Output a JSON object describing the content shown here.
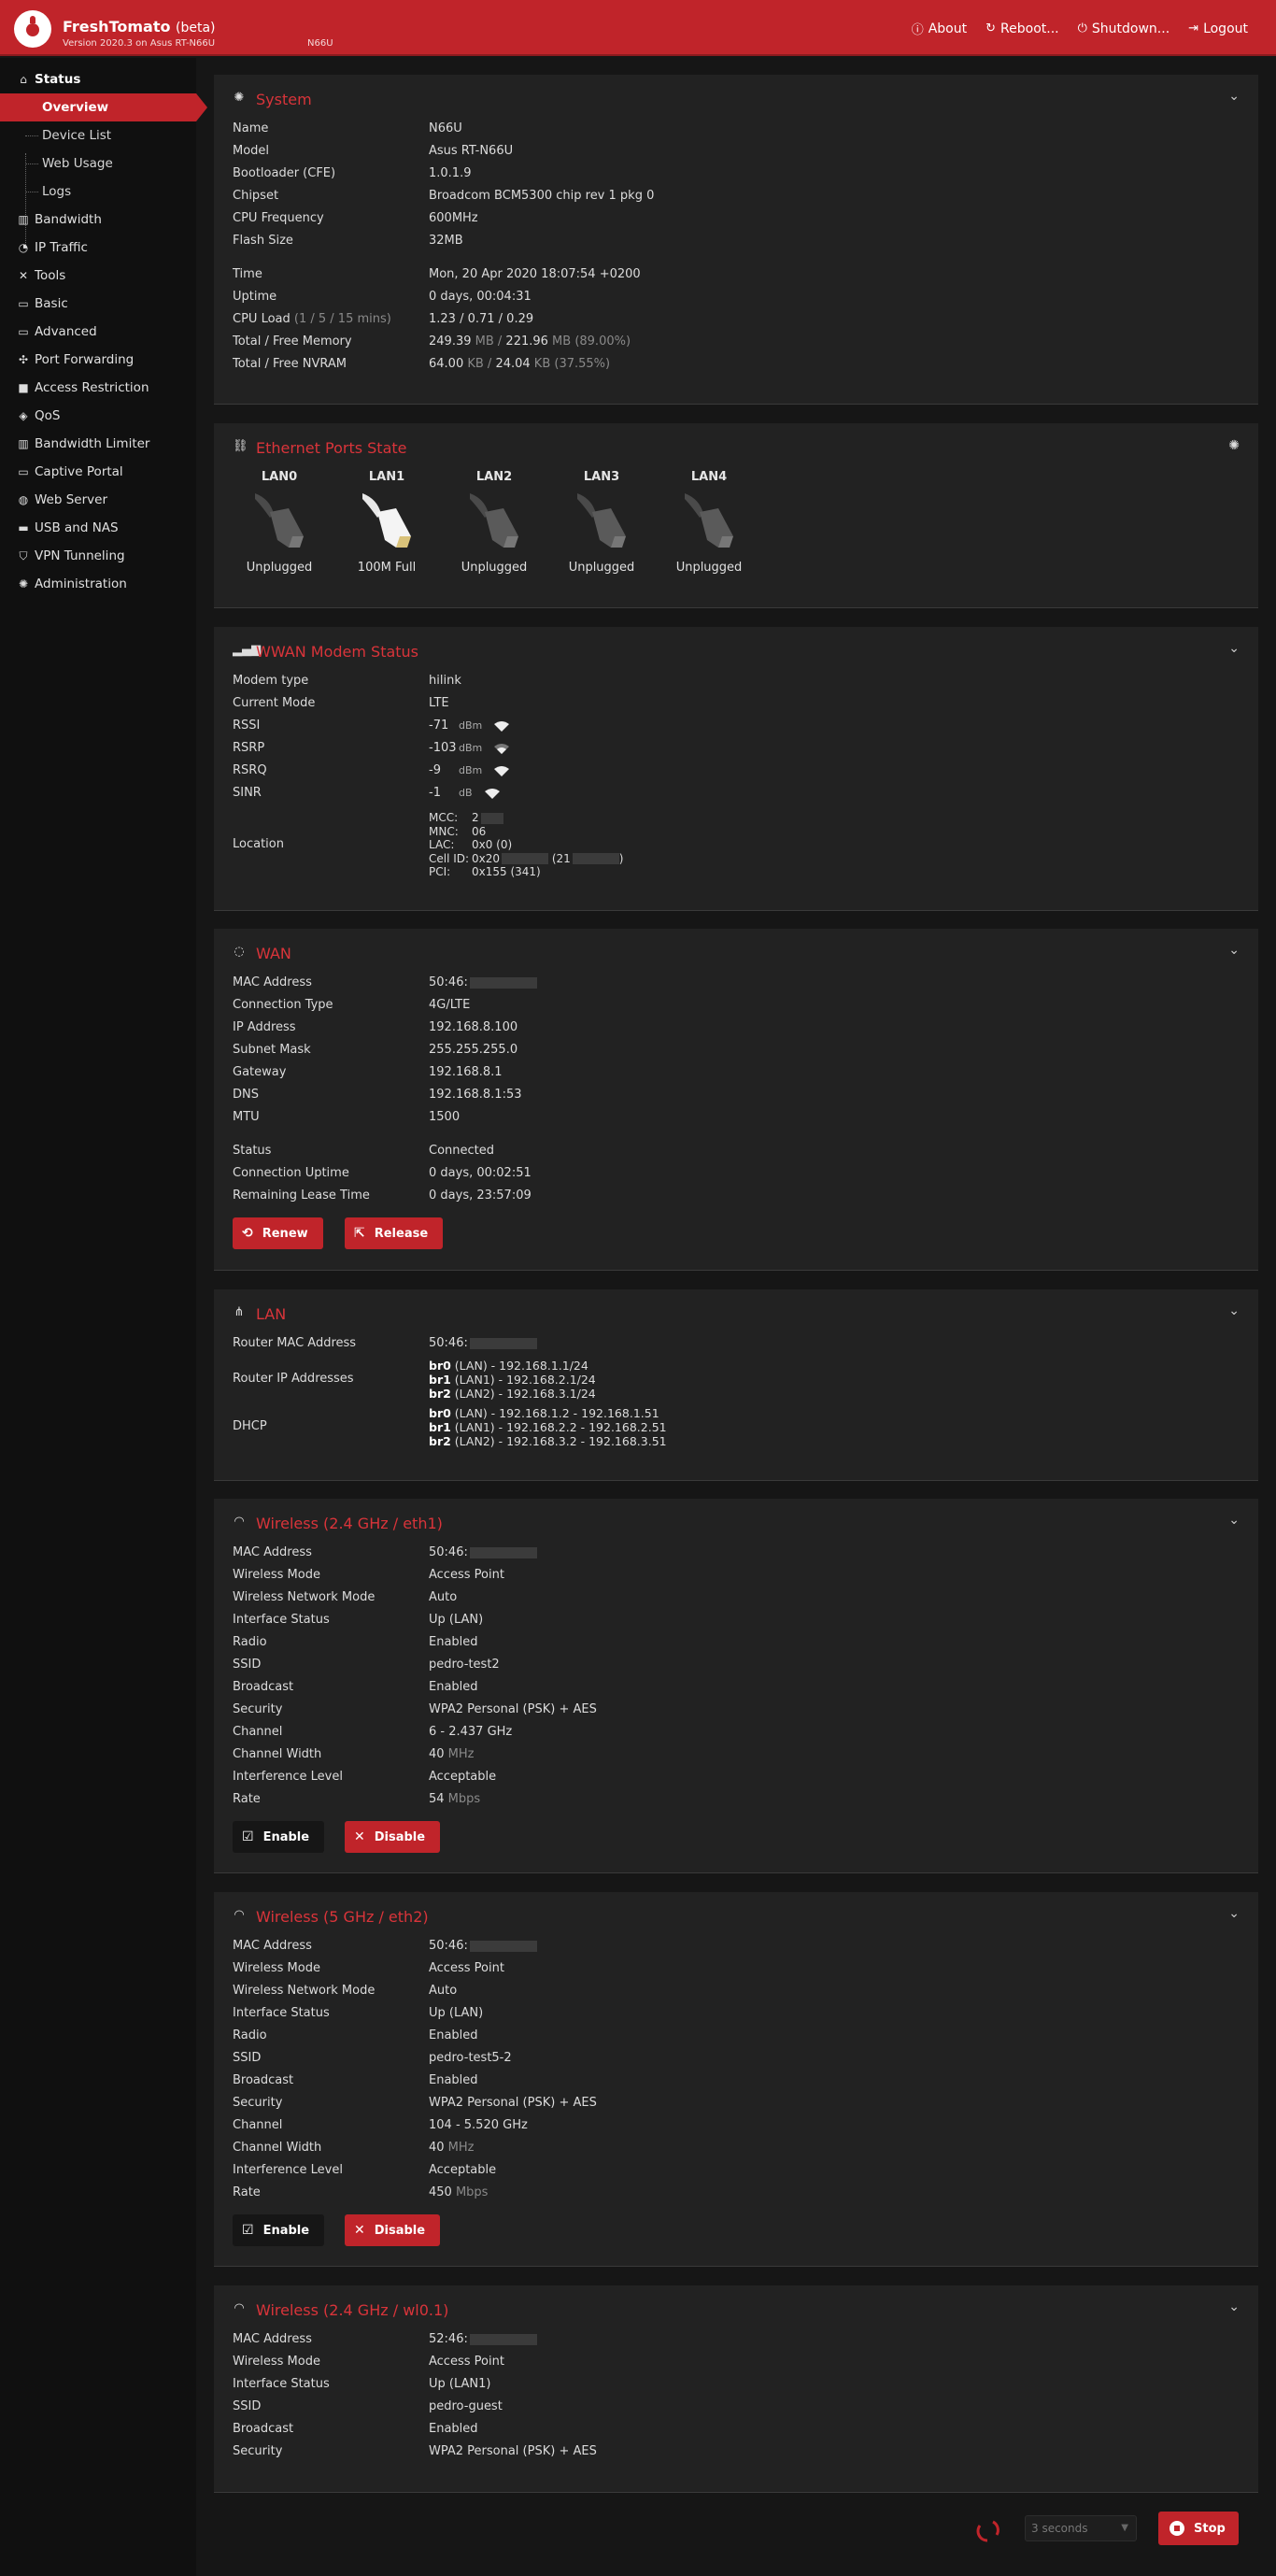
{
  "header": {
    "brand": "FreshTomato",
    "beta": "(beta)",
    "version": "Version 2020.3 on Asus RT-N66U",
    "router": "N66U",
    "links": {
      "about": "About",
      "reboot": "Reboot...",
      "shutdown": "Shutdown...",
      "logout": "Logout"
    }
  },
  "sidebar": {
    "status": "Status",
    "sub": {
      "overview": "Overview",
      "device_list": "Device List",
      "web_usage": "Web Usage",
      "logs": "Logs"
    },
    "items": {
      "bandwidth": "Bandwidth",
      "ip_traffic": "IP Traffic",
      "tools": "Tools",
      "basic": "Basic",
      "advanced": "Advanced",
      "port_forwarding": "Port Forwarding",
      "access_restriction": "Access Restriction",
      "qos": "QoS",
      "bandwidth_limiter": "Bandwidth Limiter",
      "captive_portal": "Captive Portal",
      "web_server": "Web Server",
      "usb_nas": "USB and NAS",
      "vpn": "VPN Tunneling",
      "administration": "Administration"
    }
  },
  "system": {
    "title": "System",
    "name_k": "Name",
    "name_v": "N66U",
    "model_k": "Model",
    "model_v": "Asus RT-N66U",
    "boot_k": "Bootloader (CFE)",
    "boot_v": "1.0.1.9",
    "chip_k": "Chipset",
    "chip_v": "Broadcom BCM5300 chip rev 1 pkg 0",
    "cpu_k": "CPU Frequency",
    "cpu_v": "600MHz",
    "flash_k": "Flash Size",
    "flash_v": "32MB",
    "time_k": "Time",
    "time_v": "Mon, 20 Apr 2020 18:07:54 +0200",
    "uptime_k": "Uptime",
    "uptime_v": "0 days, 00:04:31",
    "load_k": "CPU Load",
    "load_hint": "(1 / 5 / 15 mins)",
    "load_v": "1.23 / 0.71 / 0.29",
    "mem_k": "Total / Free Memory",
    "mem_a": "249.39",
    "mem_u1": " MB / ",
    "mem_b": "221.96",
    "mem_u2": " MB (89.00%)",
    "nvram_k": "Total / Free NVRAM",
    "nvram_a": "64.00",
    "nvram_u1": " KB / ",
    "nvram_b": "24.04",
    "nvram_u2": " KB (37.55%)"
  },
  "ports": {
    "title": "Ethernet Ports State",
    "list": [
      {
        "label": "LAN0",
        "state": "Unplugged"
      },
      {
        "label": "LAN1",
        "state": "100M Full"
      },
      {
        "label": "LAN2",
        "state": "Unplugged"
      },
      {
        "label": "LAN3",
        "state": "Unplugged"
      },
      {
        "label": "LAN4",
        "state": "Unplugged"
      }
    ]
  },
  "wwan": {
    "title": "WWAN Modem Status",
    "type_k": "Modem type",
    "type_v": "hilink",
    "mode_k": "Current Mode",
    "mode_v": "LTE",
    "rssi_k": "RSSI",
    "rssi_v": "-71",
    "rssi_u": "dBm",
    "rsrp_k": "RSRP",
    "rsrp_v": "-103",
    "rsrp_u": "dBm",
    "rsrq_k": "RSRQ",
    "rsrq_v": "-9",
    "rsrq_u": "dBm",
    "sinr_k": "SINR",
    "sinr_v": "-1",
    "sinr_u": "dB",
    "loc_k": "Location",
    "mcc": "MCC:",
    "mcc_v": "2",
    "mnc": "MNC:",
    "mnc_v": "06",
    "lac": "LAC:",
    "lac_v": "0x0 (0)",
    "cell": "Cell ID:",
    "cell_v": "0x20",
    "cell_v2": "(21",
    "cell_v3": ")",
    "pci": "PCI:",
    "pci_v": "0x155 (341)"
  },
  "wan": {
    "title": "WAN",
    "mac_k": "MAC Address",
    "mac_v": "50:46:",
    "ctype_k": "Connection Type",
    "ctype_v": "4G/LTE",
    "ip_k": "IP Address",
    "ip_v": "192.168.8.100",
    "mask_k": "Subnet Mask",
    "mask_v": "255.255.255.0",
    "gw_k": "Gateway",
    "gw_v": "192.168.8.1",
    "dns_k": "DNS",
    "dns_v": "192.168.8.1:53",
    "mtu_k": "MTU",
    "mtu_v": "1500",
    "status_k": "Status",
    "status_v": "Connected",
    "cup_k": "Connection Uptime",
    "cup_v": "0 days, 00:02:51",
    "lease_k": "Remaining Lease Time",
    "lease_v": "0 days, 23:57:09",
    "renew": "Renew",
    "release": "Release"
  },
  "lan": {
    "title": "LAN",
    "mac_k": "Router MAC Address",
    "mac_v": "50:46:",
    "ip_k": "Router IP Addresses",
    "ip": [
      {
        "br": "br0",
        "rest": " (LAN) - 192.168.1.1/24"
      },
      {
        "br": "br1",
        "rest": " (LAN1) - 192.168.2.1/24"
      },
      {
        "br": "br2",
        "rest": " (LAN2) - 192.168.3.1/24"
      }
    ],
    "dhcp_k": "DHCP",
    "dhcp": [
      {
        "br": "br0",
        "rest": " (LAN) - 192.168.1.2 - 192.168.1.51"
      },
      {
        "br": "br1",
        "rest": " (LAN1) - 192.168.2.2 - 192.168.2.51"
      },
      {
        "br": "br2",
        "rest": " (LAN2) - 192.168.3.2 - 192.168.3.51"
      }
    ]
  },
  "labels": {
    "mac": "MAC Address",
    "wmode": "Wireless Mode",
    "wnmode": "Wireless Network Mode",
    "istatus": "Interface Status",
    "radio": "Radio",
    "ssid": "SSID",
    "broadcast": "Broadcast",
    "security": "Security",
    "channel": "Channel",
    "cwidth": "Channel Width",
    "ilevel": "Interference Level",
    "rate": "Rate",
    "enable": "Enable",
    "disable": "Disable"
  },
  "w24": {
    "title": "Wireless (2.4 GHz / eth1)",
    "mac": "50:46:",
    "wmode": "Access Point",
    "wnmode": "Auto",
    "istatus": "Up (LAN)",
    "radio": "Enabled",
    "ssid": "pedro-test2",
    "broadcast": "Enabled",
    "security": "WPA2 Personal (PSK) + AES",
    "channel": "6 - 2.437 GHz",
    "cwidth": "40",
    "cwidth_u": " MHz",
    "ilevel": "Acceptable",
    "rate": "54",
    "rate_u": " Mbps"
  },
  "w5": {
    "title": "Wireless (5 GHz / eth2)",
    "mac": "50:46:",
    "wmode": "Access Point",
    "wnmode": "Auto",
    "istatus": "Up (LAN)",
    "radio": "Enabled",
    "ssid": "pedro-test5-2",
    "broadcast": "Enabled",
    "security": "WPA2 Personal (PSK) + AES",
    "channel": "104 - 5.520 GHz",
    "cwidth": "40",
    "cwidth_u": " MHz",
    "ilevel": "Acceptable",
    "rate": "450",
    "rate_u": " Mbps"
  },
  "wvirt": {
    "title": "Wireless (2.4 GHz / wl0.1)",
    "mac": "52:46:",
    "wmode": "Access Point",
    "istatus": "Up (LAN1)",
    "ssid": "pedro-guest",
    "broadcast": "Enabled",
    "security": "WPA2 Personal (PSK) + AES"
  },
  "footer": {
    "refresh": "3 seconds",
    "stop": "Stop"
  },
  "colors": {
    "accent": "#c0242a",
    "panel": "#222222",
    "background": "#161616"
  }
}
